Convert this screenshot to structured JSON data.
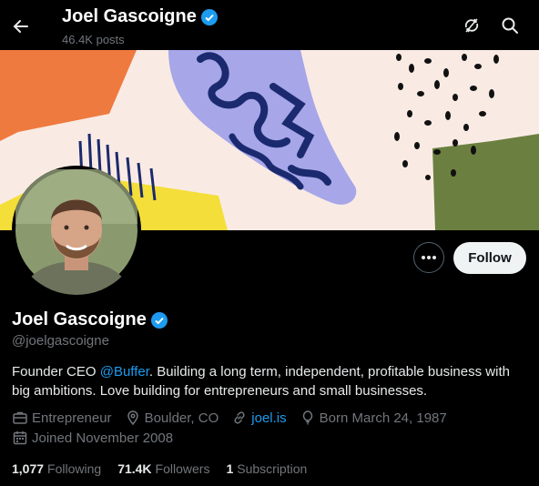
{
  "header": {
    "title": "Joel Gascoigne",
    "posts": "46.4K posts"
  },
  "profile": {
    "name": "Joel Gascoigne",
    "handle": "@joelgascoigne",
    "follow_label": "Follow",
    "bio_before": "Founder CEO ",
    "bio_mention": "@Buffer",
    "bio_after": ". Building a long term, independent, profitable business with big ambitions. Love building for entrepreneurs and small businesses.",
    "category": "Entrepreneur",
    "location": "Boulder, CO",
    "website": "joel.is",
    "born": "Born March 24, 1987",
    "joined": "Joined November 2008"
  },
  "stats": {
    "following_count": "1,077",
    "following_label": "Following",
    "followers_count": "71.4K",
    "followers_label": "Followers",
    "subscription_count": "1",
    "subscription_label": "Subscription"
  },
  "colors": {
    "accent": "#1d9bf0",
    "background": "#000000",
    "muted": "#71767b"
  },
  "icons": [
    "back-arrow-icon",
    "unfollow-sync-icon",
    "search-icon",
    "verified-badge-icon",
    "more-icon",
    "briefcase-icon",
    "location-pin-icon",
    "link-icon",
    "balloon-icon",
    "calendar-icon"
  ]
}
